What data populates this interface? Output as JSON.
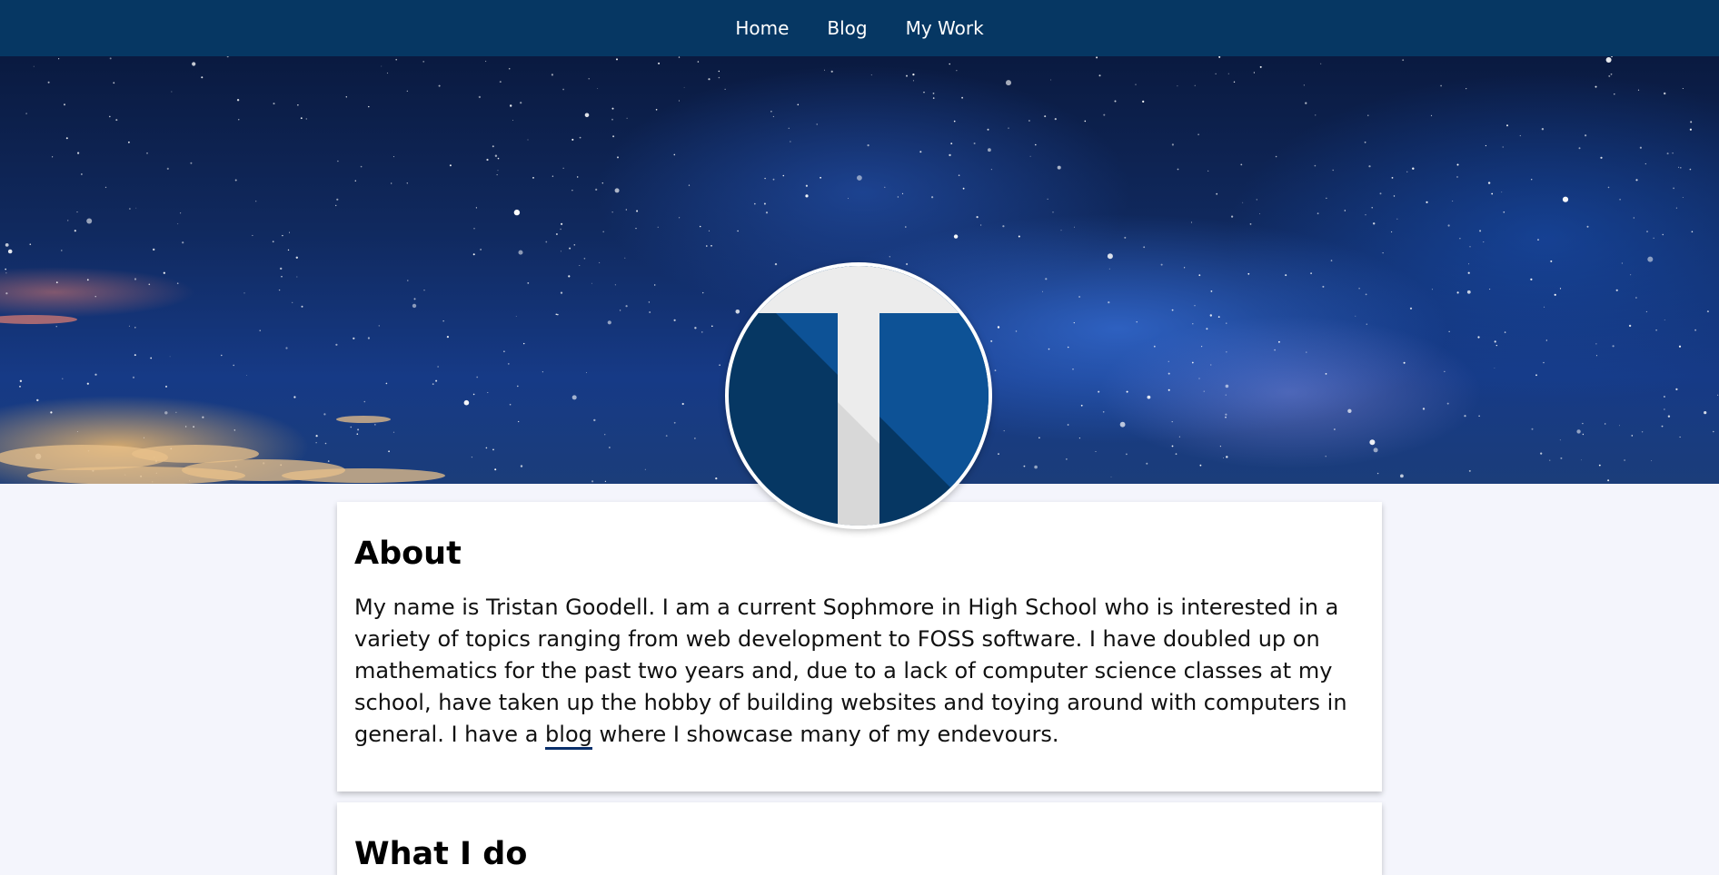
{
  "nav": {
    "items": [
      {
        "label": "Home"
      },
      {
        "label": "Blog"
      },
      {
        "label": "My Work"
      }
    ]
  },
  "colors": {
    "nav_bg": "#063763",
    "page_bg": "#f4f5fc",
    "logo_dark": "#063763",
    "logo_mid": "#0d5296",
    "link_underline": "#0a2f6b"
  },
  "about": {
    "heading": "About",
    "text_before_link": "My name is Tristan Goodell. I am a current Sophmore in High School who is interested in a variety of topics ranging from web development to FOSS software. I have doubled up on mathematics for the past two years and, due to a lack of computer science classes at my school, have taken up the hobby of building websites and toying around with computers in general. I have a ",
    "link_text": "blog",
    "text_after_link": " where I showcase many of my endevours."
  },
  "what": {
    "heading": "What I do"
  },
  "icons": {
    "logo": "letter-t-logo-icon",
    "hero": "starry-sky-banner"
  }
}
